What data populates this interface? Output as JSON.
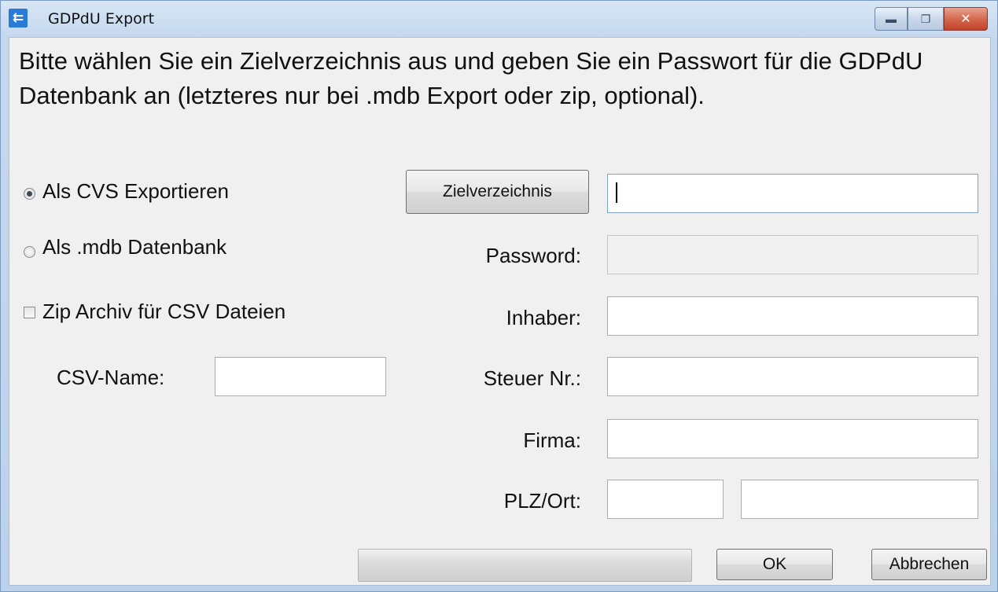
{
  "window": {
    "title": "GDPdU Export",
    "app_icon": "gdpdu-app-icon",
    "caption_buttons": {
      "minimize": "minimize-icon",
      "restore": "restore-icon",
      "close": "close-icon"
    }
  },
  "instructions": "Bitte wählen Sie ein Zielverzeichnis aus und geben Sie ein Passwort für die GDPdU Datenbank an (letzteres nur bei .mdb Export oder zip, optional).",
  "options": {
    "csv_export": {
      "label": "Als CVS Exportieren",
      "checked": true
    },
    "mdb_export": {
      "label": "Als .mdb Datenbank",
      "checked": false
    },
    "zip_archive": {
      "label": "Zip Archiv für CSV Dateien",
      "checked": false
    }
  },
  "csv_name": {
    "label": "CSV-Name:",
    "value": ""
  },
  "target_dir": {
    "button_label": "Zielverzeichnis",
    "value": ""
  },
  "fields": {
    "password": {
      "label": "Password:",
      "value": "",
      "enabled": false
    },
    "inhaber": {
      "label": "Inhaber:",
      "value": ""
    },
    "steuer_nr": {
      "label": "Steuer Nr.:",
      "value": ""
    },
    "firma": {
      "label": "Firma:",
      "value": ""
    },
    "plz_ort": {
      "label": "PLZ/Ort:",
      "plz_value": "",
      "ort_value": ""
    }
  },
  "progress": {
    "value": 0
  },
  "buttons": {
    "ok": "OK",
    "cancel": "Abbrechen"
  },
  "colors": {
    "titlebar": "#c5d8ee",
    "client_bg": "#f0f0f0",
    "close_button": "#c2402a"
  }
}
